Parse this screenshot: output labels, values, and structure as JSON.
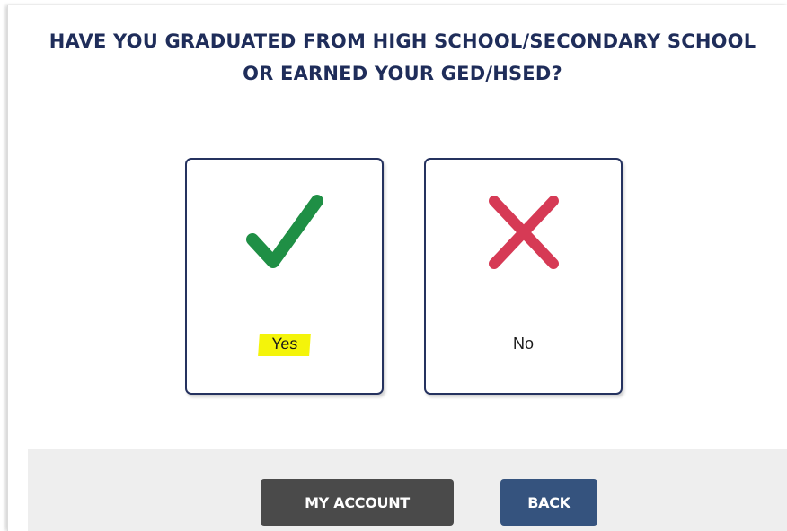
{
  "question": {
    "line1": "HAVE YOU GRADUATED FROM HIGH SCHOOL/SECONDARY SCHOOL",
    "line2": "OR EARNED YOUR GED/HSED?"
  },
  "options": [
    {
      "label": "Yes",
      "icon": "checkmark-icon",
      "icon_color": "#1f8f45",
      "highlighted": true
    },
    {
      "label": "No",
      "icon": "x-icon",
      "icon_color": "#d63a55",
      "highlighted": false
    }
  ],
  "footer": {
    "my_account_label": "MY ACCOUNT",
    "back_label": "BACK"
  },
  "colors": {
    "heading": "#1f2d5a",
    "card_border": "#25325f",
    "my_account_bg": "#4a4a4a",
    "back_bg": "#35537e",
    "highlight": "#f4f40a",
    "footer_bg": "#eeeeee"
  }
}
